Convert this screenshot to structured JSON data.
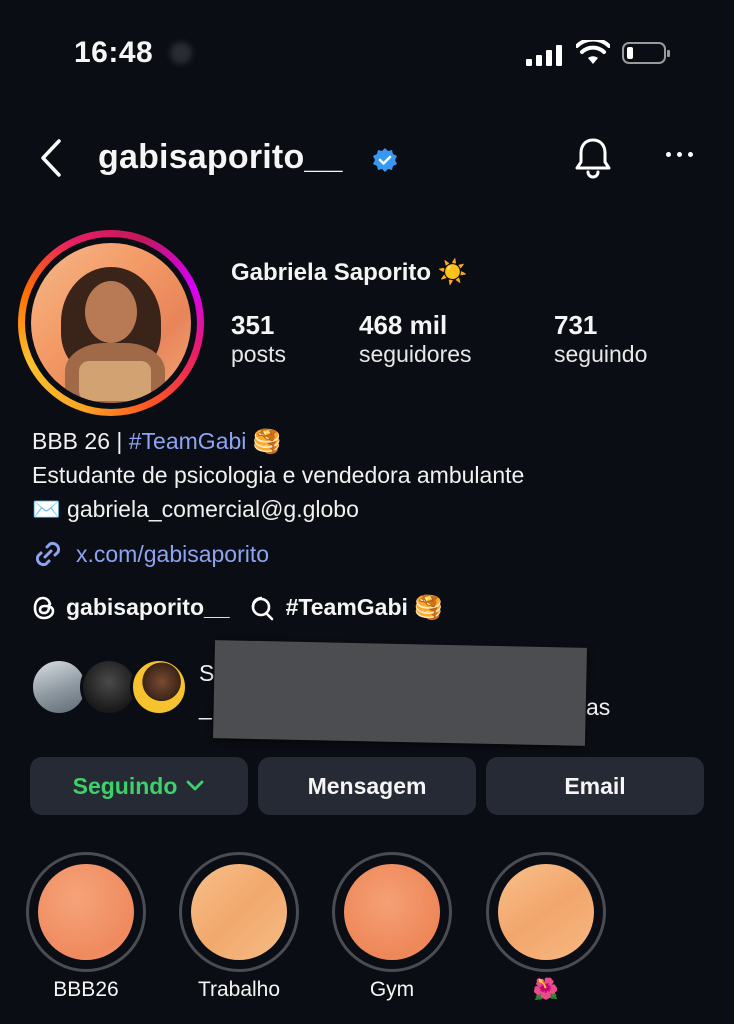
{
  "status_bar": {
    "time": "16:48",
    "signal_icon": "cellular-signal-icon",
    "wifi_icon": "wifi-icon",
    "battery_icon": "battery-low-icon"
  },
  "header": {
    "username": "gabisaporito__",
    "verified_icon": "verified-badge-icon",
    "back_icon": "chevron-left-icon",
    "notifications_icon": "bell-icon",
    "more_icon": "more-horizontal-icon"
  },
  "profile": {
    "full_name": "Gabriela Saporito ☀️",
    "stats": [
      {
        "value": "351",
        "label": "posts"
      },
      {
        "value": "468 mil",
        "label": "seguidores"
      },
      {
        "value": "731",
        "label": "seguindo"
      }
    ],
    "bio": {
      "line1_prefix": "BBB 26 | ",
      "line1_hashtag": "#TeamGabi",
      "line1_suffix": " 🥞",
      "line2": "Estudante de psicologia e vendedora ambulante",
      "line3": "✉️ gabriela_comercial@g.globo",
      "link": "x.com/gabisaporito"
    },
    "threads": {
      "handle": "gabisaporito__",
      "tag": "#TeamGabi 🥞"
    },
    "mutual_partial_1": "S",
    "mutual_partial_2": "_",
    "mutual_partial_3": "as"
  },
  "actions": {
    "following": "Seguindo",
    "message": "Mensagem",
    "email": "Email"
  },
  "highlights": [
    {
      "label": "BBB26"
    },
    {
      "label": "Trabalho"
    },
    {
      "label": "Gym"
    },
    {
      "label": "🌺"
    }
  ],
  "colors": {
    "background": "#0b0d14",
    "button_bg": "#262a34",
    "link": "#8ea4f2",
    "following_green": "#3dd16a",
    "verified_blue": "#3897f0"
  }
}
